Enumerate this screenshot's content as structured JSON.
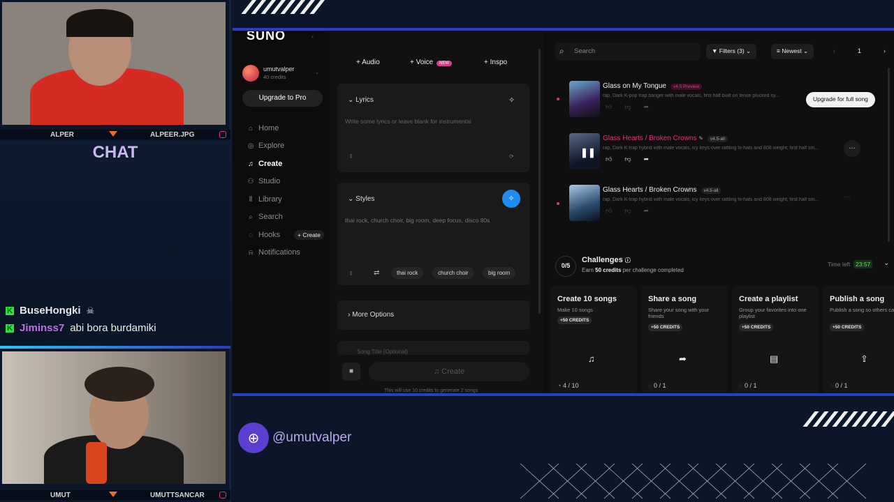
{
  "overlay": {
    "cam1": {
      "left_name": "ALPER",
      "right_name": "ALPEER.JPG"
    },
    "cam2": {
      "left_name": "UMUT",
      "right_name": "UMUTTSANCAR"
    },
    "chat": {
      "title": "CHAT",
      "messages": [
        {
          "user": "BuseHongki",
          "text": "",
          "user_color": "#e6e6e6",
          "emoji": "skull-icon"
        },
        {
          "user": "Jiminss7",
          "text": "abi bora burdamiki",
          "user_color": "#c16de8"
        }
      ]
    },
    "handle": "@umutvalper",
    "colors": {
      "accent_blue": "#2a3cc8",
      "kick_green": "#2fe03a",
      "chat_title": "#c9b7ef"
    }
  },
  "app": {
    "logo": "SUNO",
    "user": {
      "name": "umutvalper",
      "credits": "40 credits"
    },
    "upgrade_label": "Upgrade to Pro",
    "nav": [
      {
        "label": "Home",
        "icon": "home-icon"
      },
      {
        "label": "Explore",
        "icon": "compass-icon"
      },
      {
        "label": "Create",
        "icon": "music-note-icon",
        "active": true
      },
      {
        "label": "Studio",
        "icon": "studio-icon"
      },
      {
        "label": "Library",
        "icon": "library-icon"
      },
      {
        "label": "Search",
        "icon": "search-icon"
      },
      {
        "label": "Hooks",
        "icon": "hooks-icon",
        "extra": "+ Create"
      },
      {
        "label": "Notifications",
        "icon": "bell-icon"
      }
    ],
    "form": {
      "tabs": [
        "Audio",
        "Voice",
        "Inspo"
      ],
      "voice_badge": "NEW",
      "lyrics_label": "Lyrics",
      "lyrics_placeholder": "Write some lyrics or leave blank for instrumental",
      "styles_label": "Styles",
      "styles_value": "thai rock, church choir, big room, deep focus, disco 80s",
      "style_chips": [
        "thai rock",
        "church choir",
        "big room"
      ],
      "more_options": "More Options",
      "song_title_placeholder": "Song Title (Optional)",
      "create_label": "Create",
      "footnote": "This will use 10 credits to generate 2 songs"
    },
    "list": {
      "search_placeholder": "Search",
      "filters_label": "Filters (3)",
      "sort_label": "Newest",
      "page": "1",
      "upgrade_song_label": "Upgrade for full song",
      "songs": [
        {
          "title": "Glass on My Tongue",
          "badge": "v4.5 Preview",
          "badge_color": "#d43f8a",
          "desc": "rap, Dark K-pop trap banger with male vocals, first half built on tense plucked sy...",
          "title_color": "#eeeeee"
        },
        {
          "title": "Glass Hearts / Broken Crowns",
          "badge": "v4.5-all",
          "badge_color": "#555555",
          "desc": "rap, Dark K-trap hybrid with male vocals, icy keys over rattling hi-hats and 808 weight; first half sm...",
          "title_color": "#e0357a"
        },
        {
          "title": "Glass Hearts / Broken Crowns",
          "badge": "v4.5-all",
          "badge_color": "#555555",
          "desc": "rap, Dark K-trap hybrid with male vocals, icy keys over rattling hi-hats and 808 weight; first half sm...",
          "title_color": "#eeeeee"
        }
      ],
      "challenges": {
        "count": "0/5",
        "title": "Challenges",
        "subtitle_pre": "Earn ",
        "subtitle_bold": "50 credits",
        "subtitle_post": " per challenge completed",
        "time_label": "Time left",
        "time_value": "23:57",
        "cards": [
          {
            "title": "Create 10 songs",
            "desc": "Make 10 songs",
            "credits": "+50 CREDITS",
            "icon": "music-note-icon",
            "progress": "4 / 10"
          },
          {
            "title": "Share a song",
            "desc": "Share your song with your friends",
            "credits": "+50 CREDITS",
            "icon": "share-icon",
            "progress": "0 / 1"
          },
          {
            "title": "Create a playlist",
            "desc": "Group your favorites into one playlist",
            "credits": "+50 CREDITS",
            "icon": "playlist-icon",
            "progress": "0 / 1"
          },
          {
            "title": "Publish a song",
            "desc": "Publish a song so others can hear it",
            "credits": "+50 CREDITS",
            "icon": "upload-icon",
            "progress": "0 / 1"
          }
        ]
      }
    }
  }
}
